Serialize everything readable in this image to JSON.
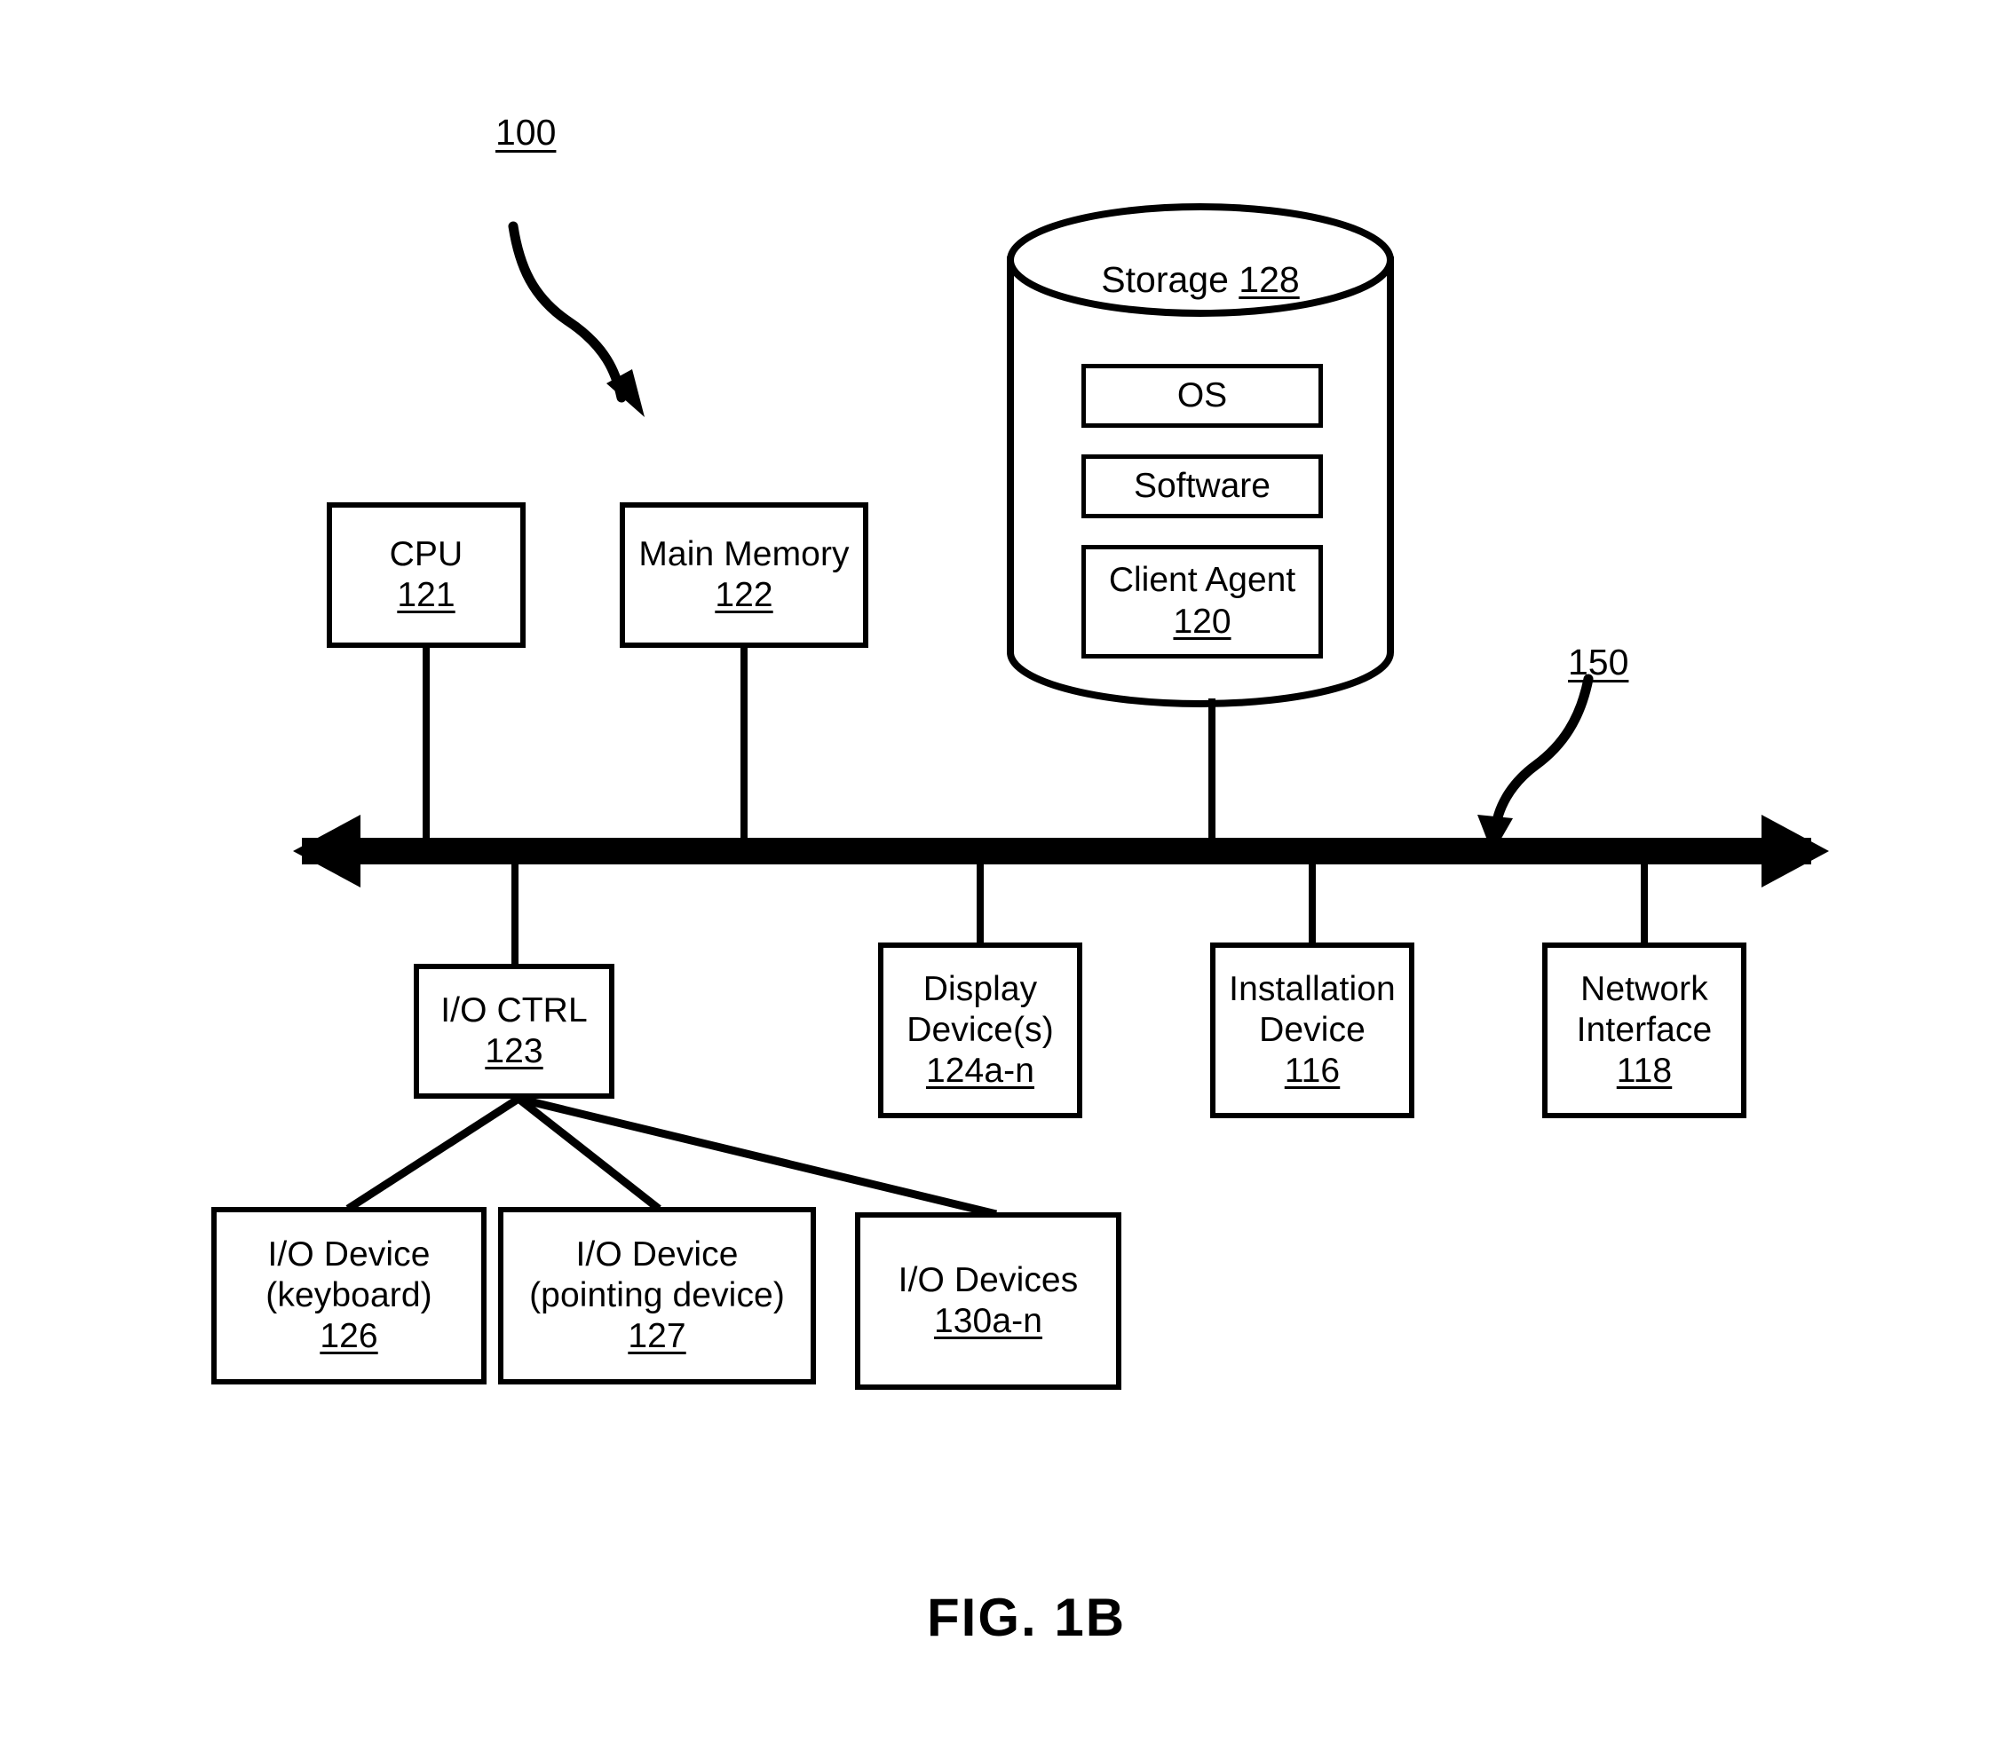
{
  "figure": {
    "caption": "FIG. 1B",
    "system_callout": "100",
    "bus_callout": "150"
  },
  "storage": {
    "title_text": "Storage ",
    "title_ref": "128",
    "items": [
      {
        "label": "OS",
        "ref": ""
      },
      {
        "label": "Software",
        "ref": ""
      },
      {
        "label": "Client Agent",
        "ref": "120"
      }
    ]
  },
  "nodes": {
    "cpu": {
      "line1": "CPU",
      "ref": "121"
    },
    "main_memory": {
      "line1": "Main Memory",
      "ref": "122"
    },
    "io_ctrl": {
      "line1": "I/O CTRL",
      "ref": "123"
    },
    "display_device": {
      "line1": "Display",
      "line2": "Device(s)",
      "ref": "124a-n"
    },
    "installation_device": {
      "line1": "Installation",
      "line2": "Device",
      "ref": "116"
    },
    "network_interface": {
      "line1": "Network",
      "line2": "Interface",
      "ref": "118"
    },
    "io_device_keyboard": {
      "line1": "I/O Device",
      "line2": "(keyboard)",
      "ref": "126"
    },
    "io_device_pointing": {
      "line1": "I/O Device",
      "line2": "(pointing device)",
      "ref": "127"
    },
    "io_devices_generic": {
      "line1": "I/O Devices",
      "ref": "130a-n"
    }
  },
  "colors": {
    "stroke": "#000000",
    "background": "#ffffff"
  }
}
